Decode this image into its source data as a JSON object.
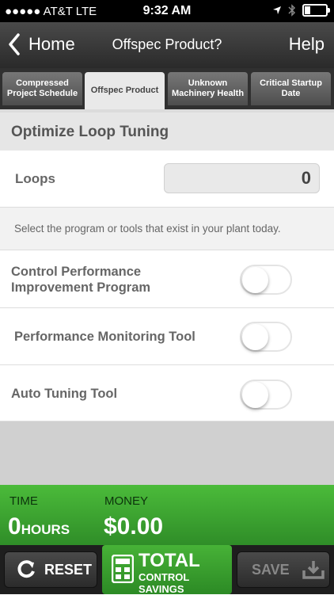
{
  "status_bar": {
    "carrier": "●●●●● AT&T  LTE",
    "time": "9:32 AM",
    "icons": [
      "location-arrow-icon",
      "bluetooth-icon",
      "battery-icon"
    ]
  },
  "nav": {
    "back_label": "Home",
    "title": "Offspec Product?",
    "help_label": "Help"
  },
  "tabs": [
    {
      "label": "Compressed Project Schedule",
      "active": false
    },
    {
      "label": "Offspec Product",
      "active": true
    },
    {
      "label": "Unknown Machinery Health",
      "active": false
    },
    {
      "label": "Critical Startup Date",
      "active": false
    }
  ],
  "section": {
    "title": "Optimize Loop Tuning"
  },
  "loops": {
    "label": "Loops",
    "value": "0"
  },
  "note": "Select the program or tools that exist in your plant today.",
  "options": [
    {
      "label": "Control Performance Improvement Program",
      "enabled": false
    },
    {
      "label": "Performance Monitoring Tool",
      "enabled": false
    },
    {
      "label": "Auto Tuning Tool",
      "enabled": false
    }
  ],
  "savings": {
    "time_label": "TIME",
    "time_value": "0",
    "time_unit": "HOURS",
    "money_label": "MONEY",
    "money_value": "$0.00"
  },
  "bottom": {
    "reset_label": "RESET",
    "total_label": "TOTAL",
    "total_sub": "CONTROL SAVINGS",
    "save_label": "SAVE"
  },
  "colors": {
    "accent_green": "#3fa832",
    "nav_dark": "#3a3a3a"
  }
}
